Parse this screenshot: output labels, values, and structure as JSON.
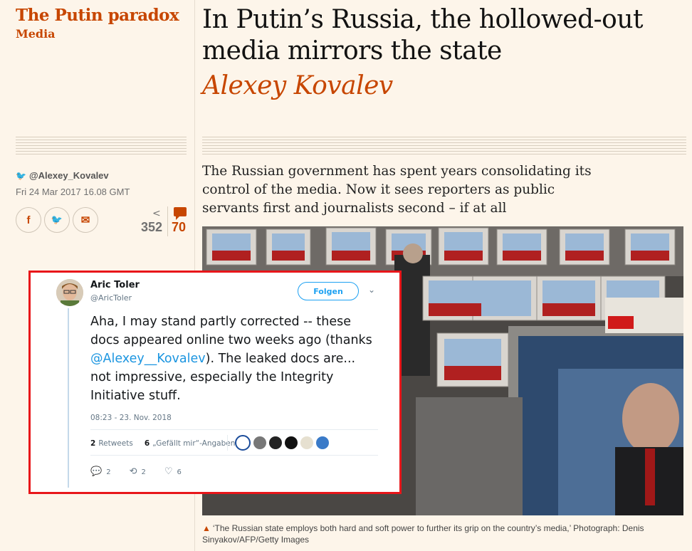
{
  "series": {
    "title": "The Putin paradox",
    "section": "Media"
  },
  "article": {
    "headline": "In Putin’s Russia, the hollowed-out media mirrors the state",
    "author": "Alexey Kovalev",
    "standfirst": "The Russian government has spent years consolidating its control of the media. Now it sees reporters as public servants first and journalists second – if at all",
    "byline_handle": "@Alexey_Kovalev",
    "date": "Fri 24 Mar 2017 16.08 GMT",
    "share_count": "352",
    "comment_count": "70",
    "caption": "‘The Russian state employs both hard and soft power to further its grip on the country’s media,’ Photograph: Denis Sinyakov/AFP/Getty Images"
  },
  "share_icons": [
    "facebook-icon",
    "twitter-icon",
    "email-icon"
  ],
  "share_labels": {
    "facebook": "f",
    "twitter": "🐦",
    "email": "✉"
  },
  "tweet": {
    "name": "Aric Toler",
    "handle": "@AricToler",
    "follow_label": "Folgen",
    "text_before": "Aha, I may stand partly corrected -- these docs appeared online two weeks ago (thanks ",
    "mention": "@Alexey__Kovalev",
    "text_after": "). The leaked docs are... not impressive, especially the Integrity Initiative stuff.",
    "timestamp": "08:23 - 23. Nov. 2018",
    "retweets_count": "2",
    "retweets_label": "Retweets",
    "likes_count": "6",
    "likes_label": "„Gefällt mir“-Angaben",
    "reply_count": "2",
    "retweet_count": "2",
    "like_count": "6"
  },
  "colors": {
    "accent": "#c74600",
    "tweet_border": "#e8161a",
    "link": "#1b95e0",
    "background": "#fdf5ea"
  }
}
